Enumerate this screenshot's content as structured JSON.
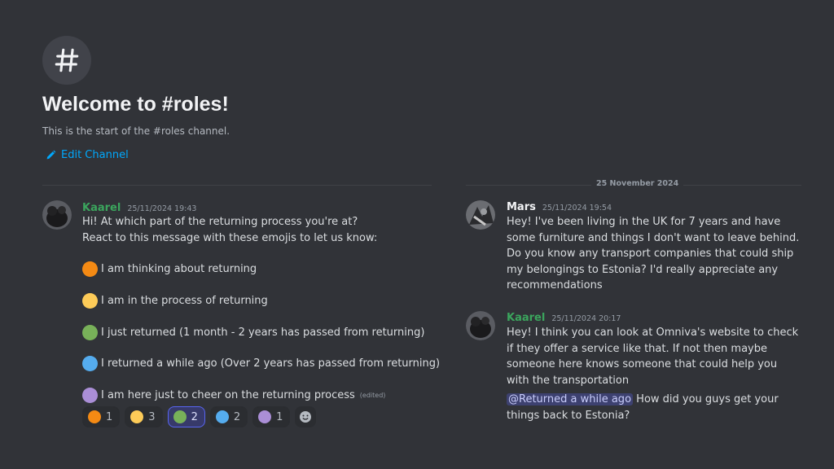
{
  "hero": {
    "title": "Welcome to #roles!",
    "subtitle": "This is the start of the #roles channel.",
    "edit_label": "Edit Channel"
  },
  "date_divider": "25 November 2024",
  "messages": [
    {
      "author": "Kaarel",
      "timestamp": "25/11/2024 19:43",
      "line1": "Hi! At which part of the returning process you're at?",
      "line2": "React to this message with these emojis to let us know:",
      "roles": [
        {
          "text": "I am thinking about returning",
          "color": "#f48a14"
        },
        {
          "text": "I am in the process of returning",
          "color": "#fdcb58"
        },
        {
          "text": "I just returned (1 month - 2 years has passed from returning)",
          "color": "#78b159"
        },
        {
          "text": "I returned a while ago (Over 2 years has passed from returning)",
          "color": "#55acee"
        },
        {
          "text": "I am here just to cheer on the returning process",
          "color": "#aa8ed6",
          "edited": "(edited)"
        }
      ],
      "reactions": [
        {
          "color": "#f48a14",
          "count": "1"
        },
        {
          "color": "#fdcb58",
          "count": "3"
        },
        {
          "color": "#78b159",
          "count": "2",
          "me": true
        },
        {
          "color": "#55acee",
          "count": "2"
        },
        {
          "color": "#aa8ed6",
          "count": "1"
        }
      ]
    },
    {
      "author": "Mars",
      "timestamp": "25/11/2024 19:54",
      "lines": [
        "Hey! I've been living in the UK for 7 years and have",
        "some furniture and things I don't want to leave behind.",
        "Do you know any transport companies that could ship",
        "my belongings to Estonia? I'd really appreciate any",
        "recommendations"
      ]
    },
    {
      "author": "Kaarel",
      "timestamp": "25/11/2024 20:17",
      "lines": [
        "Hey! I think you can look at Omniva's website to check",
        "if they offer a service like that. If not then maybe",
        "someone here knows someone that could help you",
        "with the transportation"
      ],
      "mention": "@Returned a while ago",
      "after_mention": " How did you guys get your",
      "last_line": "things back to Estonia?"
    }
  ]
}
